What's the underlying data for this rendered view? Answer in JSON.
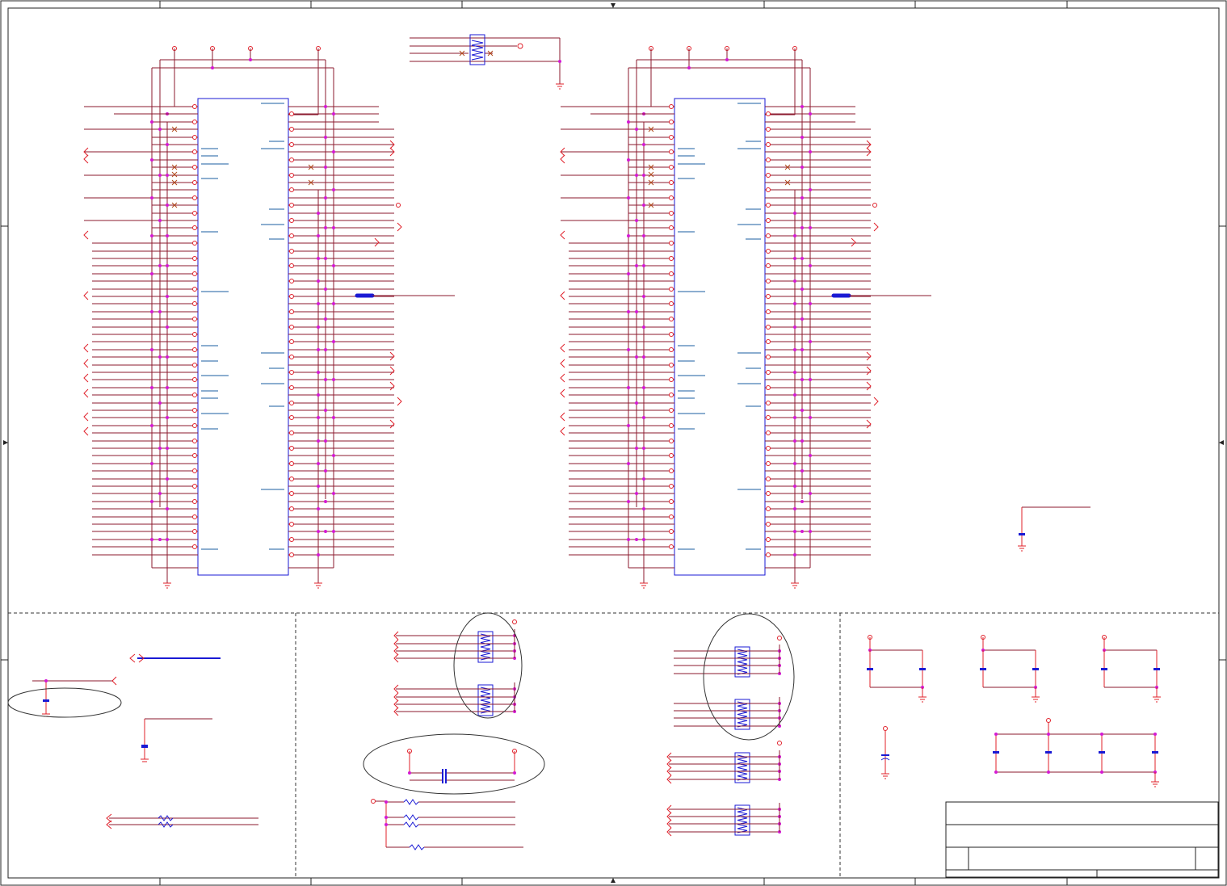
{
  "title_block": {
    "title": "",
    "size_label": "",
    "sheet_label": ""
  },
  "colors": {
    "wire": "#8b1a2e",
    "pin": "#e0202a",
    "junction": "#d41ad4",
    "part_outline": "#1a1ad4",
    "net_label": "#1a5ea0",
    "border": "#222222",
    "dashed_frame": "#333333"
  }
}
